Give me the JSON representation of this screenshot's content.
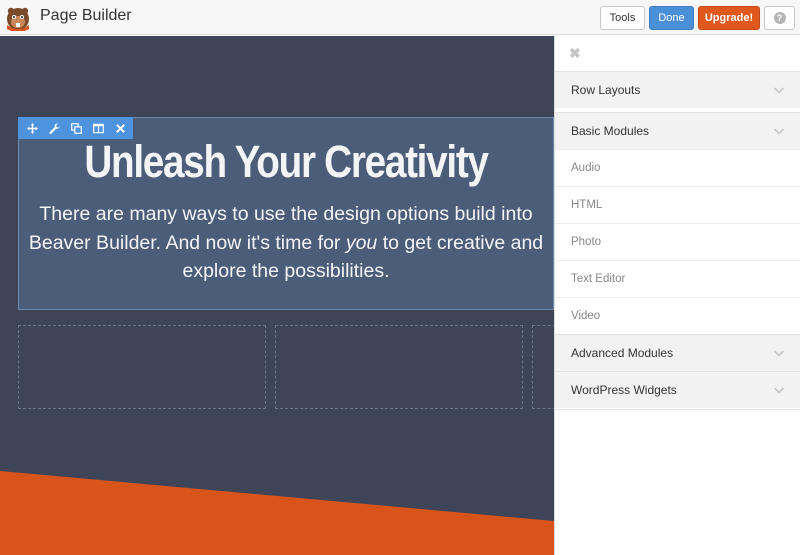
{
  "header": {
    "title": "Page Builder",
    "tools_label": "Tools",
    "done_label": "Done",
    "upgrade_label": "Upgrade!",
    "help_label": "?"
  },
  "canvas": {
    "headline": "Unleash Your Creativity",
    "body_before": "There are many ways to use the design options build into Beaver Builder. And now it's time for ",
    "body_emphasis": "you",
    "body_after": " to get creative and explore the possibilities.",
    "toolbar_icons": [
      "move-icon",
      "wrench-icon",
      "copy-icon",
      "columns-icon",
      "close-icon"
    ]
  },
  "sidebar": {
    "close_label": "✖",
    "sections": [
      {
        "label": "Row Layouts"
      },
      {
        "label": "Basic Modules"
      },
      {
        "label": "Advanced Modules"
      },
      {
        "label": "WordPress Widgets"
      }
    ],
    "basic_modules": [
      "Audio",
      "HTML",
      "Photo",
      "Text Editor",
      "Video"
    ]
  },
  "colors": {
    "canvas_bg": "#3f4558",
    "row_bg": "#4c5d79",
    "accent_blue": "#4d93de",
    "orange": "#d9541b",
    "done_blue": "#4a90d9",
    "upgrade_orange": "#e0581e"
  }
}
